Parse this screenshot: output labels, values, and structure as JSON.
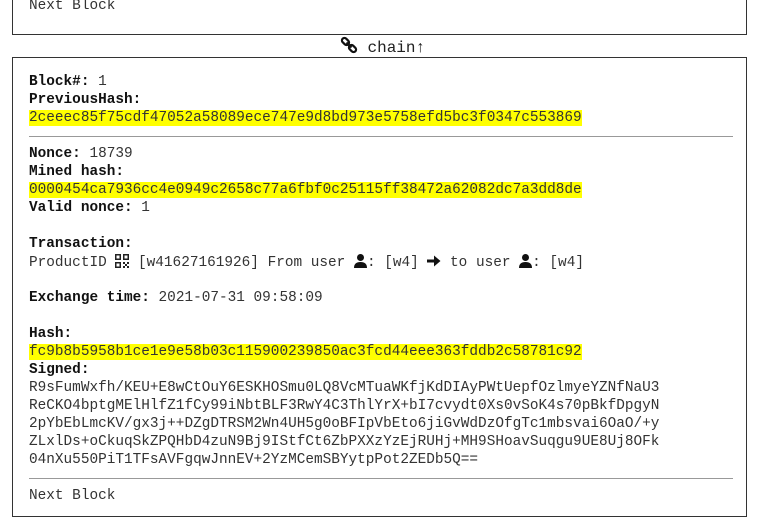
{
  "top_block": {
    "next_label": "Next Block"
  },
  "chain_link": {
    "icon": "link-icon",
    "label": "chain",
    "arrow": "↑"
  },
  "block": {
    "number_label": "Block#:",
    "number": "1",
    "previous_hash_label": "PreviousHash:",
    "previous_hash": "2ceeec85f75cdf47052a58089ece747e9d8bd973e5758efd5bc3f0347c553869",
    "nonce_label": "Nonce:",
    "nonce": "18739",
    "mined_hash_label": "Mined hash:",
    "mined_hash": "0000454ca7936cc4e0949c2658c77a6fbf0c25115ff38472a62082dc7a3dd8de",
    "valid_nonce_label": "Valid nonce:",
    "valid_nonce": "1",
    "transaction_label": "Transaction:",
    "product_prefix": "ProductID",
    "product_id": "[w41627161926]",
    "from_text": "From user",
    "from_user": "[w4]",
    "to_text": "to user",
    "to_user": "[w4]",
    "exchange_time_label": "Exchange time:",
    "exchange_time": "2021-07-31 09:58:09",
    "hash_label": "Hash:",
    "hash": "fc9b8b5958b1ce1e9e58b03c115900239850ac3fcd44eee363fddb2c58781c92",
    "signed_label": "Signed:",
    "signed_lines": [
      "R9sFumWxfh/KEU+E8wCtOuY6ESKHOSmu0LQ8VcMTuaWKfjKdDIAyPWtUepfOzlmyeYZNfNaU3",
      "ReCKO4bptgMElHlfZ1fCy99iNbtBLF3RwY4C3ThlYrX+bI7cvydt0Xs0vSoK4s70pBkfDpgyN",
      "2pYbEbLmcKV/gx3j++DZgDTRSM2Wn4UH5g0oBFIpVbEto6jiGvWdDzOfgTc1mbsvai6OaO/+y",
      "ZLxlDs+oCkuqSkZPQHbD4zuN9Bj9IStfCt6ZbPXXzYzEjRUHj+MH9SHoavSuqgu9UE8Uj8OFk",
      "04nXu550PiT1TFsAVFgqwJnnEV+2YzMCemSBYytpPot2ZEDb5Q=="
    ],
    "next_label": "Next Block"
  }
}
